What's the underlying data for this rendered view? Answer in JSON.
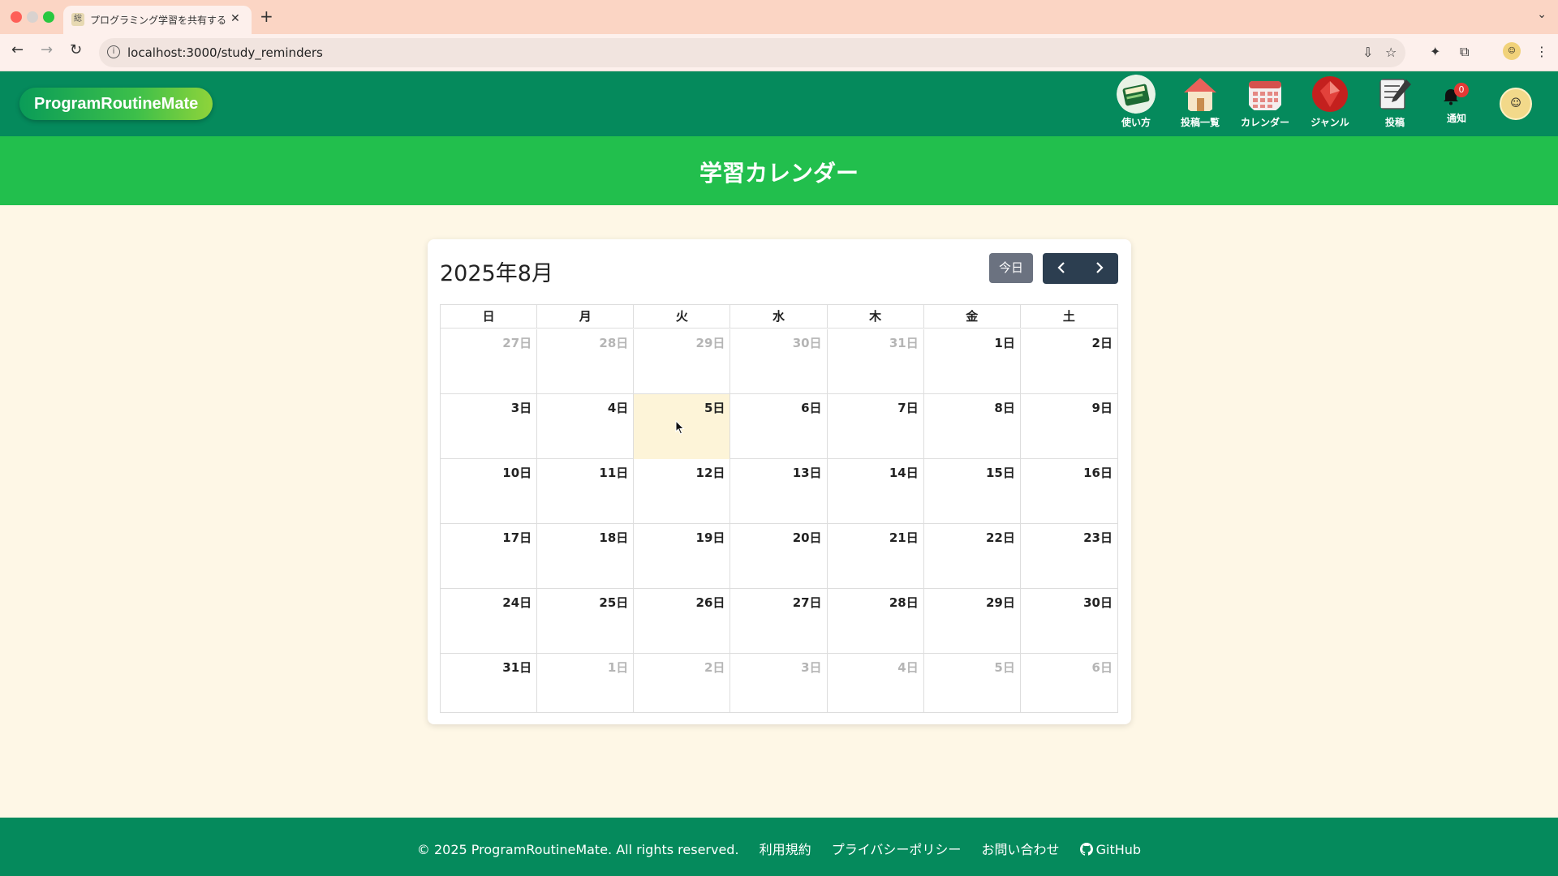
{
  "browser": {
    "tab_title": "プログラミング学習を共有するア",
    "tab_favicon": "総",
    "url": "localhost:3000/study_reminders"
  },
  "header": {
    "logo": "ProgramRoutineMate",
    "nav": [
      {
        "label": "使い方",
        "icon": "howto-book-icon"
      },
      {
        "label": "投稿一覧",
        "icon": "house-icon"
      },
      {
        "label": "カレンダー",
        "icon": "calendar-icon"
      },
      {
        "label": "ジャンル",
        "icon": "ruby-gem-icon"
      },
      {
        "label": "投稿",
        "icon": "write-post-icon"
      }
    ],
    "notification": {
      "label": "通知",
      "count": "0"
    },
    "avatar": "総"
  },
  "page_title": "学習カレンダー",
  "calendar": {
    "title": "2025年8月",
    "today_label": "今日",
    "weekdays": [
      "日",
      "月",
      "火",
      "水",
      "木",
      "金",
      "土"
    ],
    "weeks": [
      [
        {
          "d": "27日",
          "other": true
        },
        {
          "d": "28日",
          "other": true
        },
        {
          "d": "29日",
          "other": true
        },
        {
          "d": "30日",
          "other": true
        },
        {
          "d": "31日",
          "other": true
        },
        {
          "d": "1日"
        },
        {
          "d": "2日"
        }
      ],
      [
        {
          "d": "3日"
        },
        {
          "d": "4日"
        },
        {
          "d": "5日",
          "today": true
        },
        {
          "d": "6日"
        },
        {
          "d": "7日"
        },
        {
          "d": "8日"
        },
        {
          "d": "9日"
        }
      ],
      [
        {
          "d": "10日"
        },
        {
          "d": "11日"
        },
        {
          "d": "12日"
        },
        {
          "d": "13日"
        },
        {
          "d": "14日"
        },
        {
          "d": "15日"
        },
        {
          "d": "16日"
        }
      ],
      [
        {
          "d": "17日"
        },
        {
          "d": "18日"
        },
        {
          "d": "19日"
        },
        {
          "d": "20日"
        },
        {
          "d": "21日"
        },
        {
          "d": "22日"
        },
        {
          "d": "23日"
        }
      ],
      [
        {
          "d": "24日"
        },
        {
          "d": "25日"
        },
        {
          "d": "26日"
        },
        {
          "d": "27日"
        },
        {
          "d": "28日"
        },
        {
          "d": "29日"
        },
        {
          "d": "30日"
        }
      ],
      [
        {
          "d": "31日"
        },
        {
          "d": "1日",
          "other": true
        },
        {
          "d": "2日",
          "other": true
        },
        {
          "d": "3日",
          "other": true
        },
        {
          "d": "4日",
          "other": true
        },
        {
          "d": "5日",
          "other": true
        },
        {
          "d": "6日",
          "other": true
        }
      ]
    ]
  },
  "footer": {
    "copyright": "© 2025 ProgramRoutineMate. All rights reserved.",
    "terms": "利用規約",
    "privacy": "プライバシーポリシー",
    "contact": "お問い合わせ",
    "github": "GitHub"
  },
  "colors": {
    "header_bg": "#058a5c",
    "title_band": "#22bf4d",
    "page_bg": "#fef7e6",
    "today_cell": "#fdf4d8",
    "nav_button": "#2c3e50",
    "today_button": "#6b7280"
  }
}
